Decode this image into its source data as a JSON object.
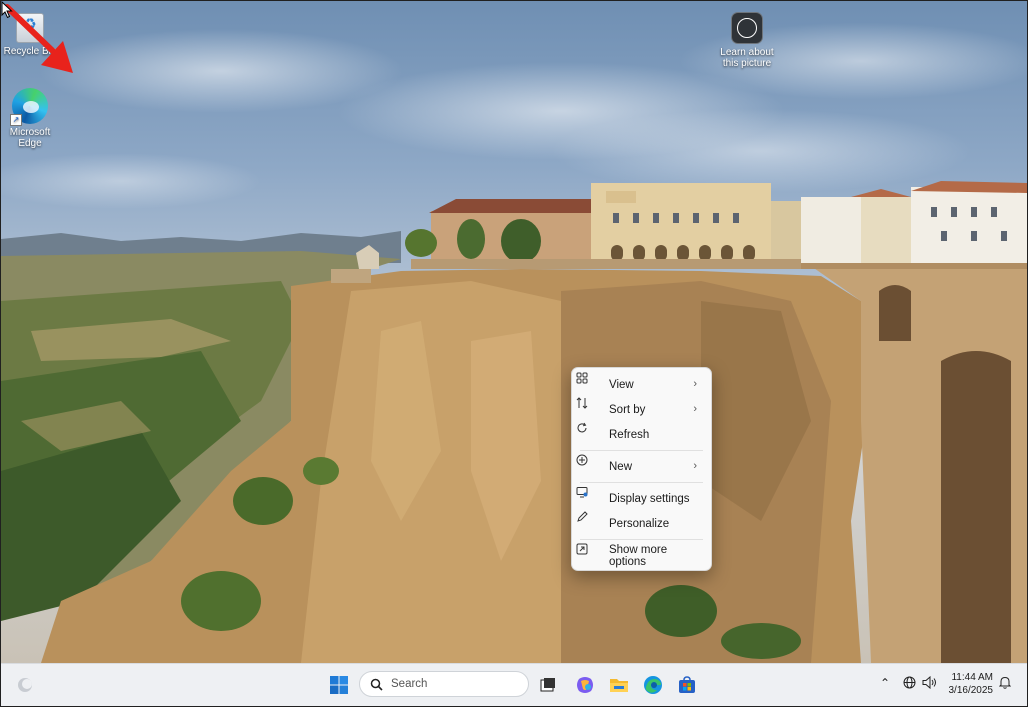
{
  "desktop": {
    "icons": [
      {
        "label": "Recycle Bin",
        "icon": "recycle-bin-icon"
      },
      {
        "label": "Microsoft Edge",
        "icon": "edge-icon"
      }
    ],
    "learn_picture": {
      "label": "Learn about this picture",
      "icon": "learn-picture-icon"
    }
  },
  "context_menu": {
    "items": [
      {
        "label": "View",
        "icon": "view-grid-icon",
        "submenu": true
      },
      {
        "label": "Sort by",
        "icon": "sort-icon",
        "submenu": true
      },
      {
        "label": "Refresh",
        "icon": "refresh-icon",
        "submenu": false
      },
      {
        "label": "New",
        "icon": "new-plus-icon",
        "submenu": true
      },
      {
        "label": "Display settings",
        "icon": "display-icon",
        "submenu": false
      },
      {
        "label": "Personalize",
        "icon": "pen-icon",
        "submenu": false
      },
      {
        "label": "Show more options",
        "icon": "more-options-icon",
        "submenu": false
      }
    ]
  },
  "taskbar": {
    "search_placeholder": "Search",
    "apps": [
      "start-icon",
      "task-view-icon",
      "copilot-icon",
      "file-explorer-icon",
      "edge-icon",
      "store-icon"
    ],
    "time": "11:44 AM",
    "date": "3/16/2025"
  },
  "colors": {
    "annotation_arrow": "#e8231c",
    "taskbar_bg": "#eef0f3",
    "menu_bg": "#f9f9f9"
  }
}
